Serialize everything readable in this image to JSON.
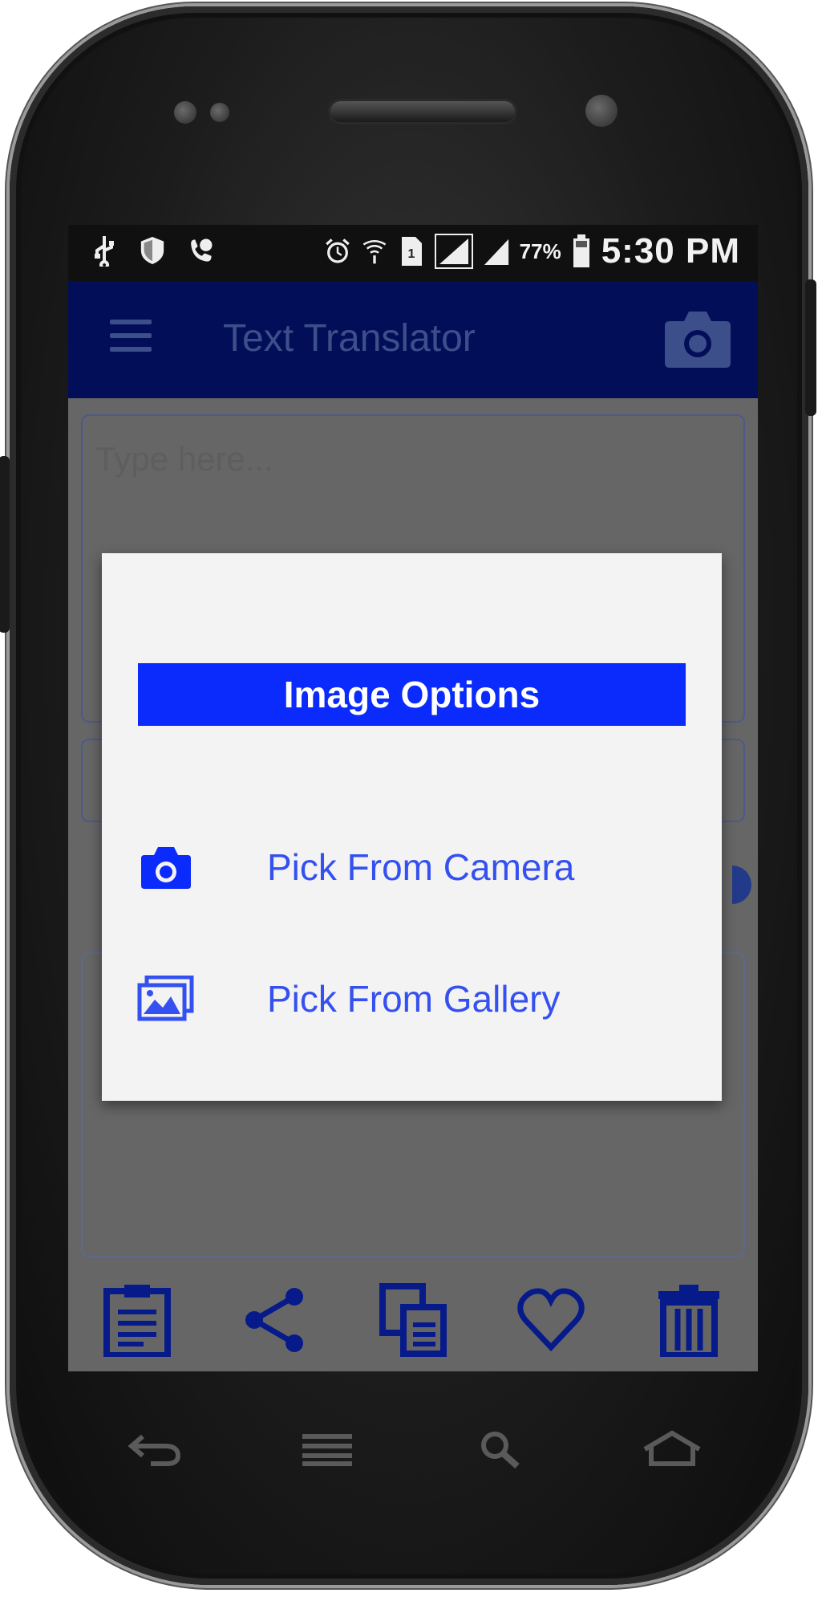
{
  "status_bar": {
    "battery_percent": "77%",
    "time": "5:30 PM",
    "icons": [
      "usb-icon",
      "shield-icon",
      "phone-icon",
      "alarm-icon",
      "wifi-icon",
      "sim-icon",
      "signal-icon",
      "signal-icon",
      "battery-icon"
    ]
  },
  "app_bar": {
    "title": "Text Translator",
    "menu_icon": "hamburger-menu-icon",
    "camera_icon": "camera-icon"
  },
  "input": {
    "placeholder": "Type here..."
  },
  "bottom_bar": {
    "icons": [
      "clipboard-icon",
      "share-icon",
      "copy-icon",
      "heart-icon",
      "trash-icon"
    ]
  },
  "dialog": {
    "title": "Image Options",
    "options": [
      {
        "label": "Pick From Camera",
        "icon": "camera-icon"
      },
      {
        "label": "Pick From Gallery",
        "icon": "gallery-icon"
      }
    ]
  },
  "nav_bar": {
    "icons": [
      "back-icon",
      "menu-icon",
      "search-icon",
      "home-icon"
    ]
  },
  "colors": {
    "app_bar": "#020e58",
    "dialog_title_bg": "#0a2bfb",
    "option_text": "#3550f0",
    "screen_dim": "#666666"
  }
}
